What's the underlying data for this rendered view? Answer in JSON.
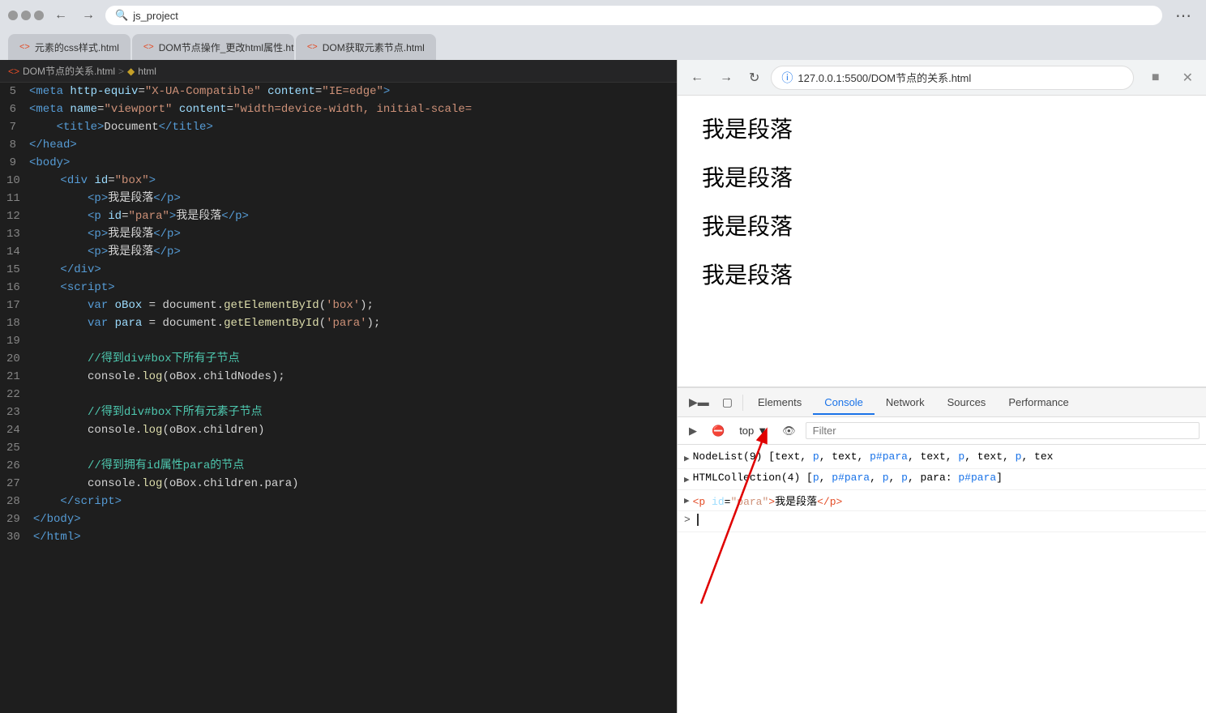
{
  "browser": {
    "title": "Document",
    "tabs": [
      {
        "label": "元素的css样式.html",
        "active": false
      },
      {
        "label": "DOM节点操作_更改html属性.html",
        "active": false
      },
      {
        "label": "DOM获取元素节点.html",
        "active": false
      }
    ],
    "search_placeholder": "js_project",
    "address": "127.0.0.1:5500/DOM节点的关系.html",
    "breadcrumb": [
      "DOM节点的关系.html",
      "html"
    ]
  },
  "devtools": {
    "tabs": [
      "Elements",
      "Console",
      "Network",
      "Sources",
      "Performance"
    ],
    "active_tab": "Console",
    "toolbar": {
      "top_label": "top",
      "filter_placeholder": "Filter"
    },
    "console_lines": [
      {
        "type": "expandable",
        "text": "NodeList(9) [text, p, text, p#para, text, p, text, p, tex"
      },
      {
        "type": "expandable",
        "text": "HTMLCollection(4) [p, p#para, p, p, para: p#para]"
      },
      {
        "type": "element",
        "text": "<p id=\"para\">我是段落</p>"
      }
    ],
    "prompt_text": ""
  },
  "preview": {
    "paragraphs": [
      "我是段落",
      "我是段落",
      "我是段落",
      "我是段落"
    ]
  },
  "code": {
    "lines": [
      {
        "num": 5,
        "html": "<span class='c-tag'>&lt;meta</span> <span class='c-attr'>http-equiv</span><span class='c-text'>=</span><span class='c-val'>\"X-UA-Compatible\"</span> <span class='c-attr'>content</span><span class='c-text'>=</span><span class='c-val'>\"IE=edge\"</span><span class='c-tag'>&gt;</span>"
      },
      {
        "num": 6,
        "html": "<span class='c-tag'>&lt;meta</span> <span class='c-attr'>name</span><span class='c-text'>=</span><span class='c-val'>\"viewport\"</span> <span class='c-attr'>content</span><span class='c-text'>=</span><span class='c-val'>\"width=device-width, initial-scale=</span>"
      },
      {
        "num": 7,
        "html": "    <span class='c-tag'>&lt;title&gt;</span><span class='c-text'>Document</span><span class='c-tag'>&lt;/title&gt;</span>"
      },
      {
        "num": 8,
        "html": "<span class='c-tag'>&lt;/head&gt;</span>"
      },
      {
        "num": 9,
        "html": "<span class='c-tag'>&lt;body&gt;</span>"
      },
      {
        "num": 10,
        "html": "    <span class='c-tag'>&lt;div</span> <span class='c-attr'>id</span><span class='c-text'>=</span><span class='c-val'>\"box\"</span><span class='c-tag'>&gt;</span>"
      },
      {
        "num": 11,
        "html": "        <span class='c-tag'>&lt;p&gt;</span><span class='c-text'>我是段落</span><span class='c-tag'>&lt;/p&gt;</span>"
      },
      {
        "num": 12,
        "html": "        <span class='c-tag'>&lt;p</span> <span class='c-attr'>id</span><span class='c-text'>=</span><span class='c-val'>\"para\"</span><span class='c-tag'>&gt;</span><span class='c-text'>我是段落</span><span class='c-tag'>&lt;/p&gt;</span>"
      },
      {
        "num": 13,
        "html": "        <span class='c-tag'>&lt;p&gt;</span><span class='c-text'>我是段落</span><span class='c-tag'>&lt;/p&gt;</span>"
      },
      {
        "num": 14,
        "html": "        <span class='c-tag'>&lt;p&gt;</span><span class='c-text'>我是段落</span><span class='c-tag'>&lt;/p&gt;</span>"
      },
      {
        "num": 15,
        "html": "    <span class='c-tag'>&lt;/div&gt;</span>"
      },
      {
        "num": 16,
        "html": "    <span class='c-tag'>&lt;script&gt;</span>"
      },
      {
        "num": 17,
        "html": "        <span class='c-keyword'>var</span> <span class='c-var'>oBox</span> <span class='c-text'>= document.</span><span class='c-fn'>getElementById</span><span class='c-text'>(</span><span class='c-string'>'box'</span><span class='c-text'>);</span>"
      },
      {
        "num": 18,
        "html": "        <span class='c-keyword'>var</span> <span class='c-var'>para</span> <span class='c-text'>= document.</span><span class='c-fn'>getElementById</span><span class='c-text'>(</span><span class='c-string'>'para'</span><span class='c-text'>);</span>"
      },
      {
        "num": 19,
        "html": ""
      },
      {
        "num": 20,
        "html": "        <span class='c-comment'>//得到div#box下所有子节点</span>"
      },
      {
        "num": 21,
        "html": "        <span class='c-text'>console.</span><span class='c-fn'>log</span><span class='c-text'>(oBox.childNodes);</span>"
      },
      {
        "num": 22,
        "html": ""
      },
      {
        "num": 23,
        "html": "        <span class='c-comment'>//得到div#box下所有元素子节点</span>"
      },
      {
        "num": 24,
        "html": "        <span class='c-text'>console.</span><span class='c-fn'>log</span><span class='c-text'>(oBox.children)</span>"
      },
      {
        "num": 25,
        "html": ""
      },
      {
        "num": 26,
        "html": "        <span class='c-comment'>//得到拥有id属性para的节点</span>"
      },
      {
        "num": 27,
        "html": "        <span class='c-text'>console.</span><span class='c-fn'>log</span><span class='c-text'>(oBox.children.para)</span>"
      },
      {
        "num": 28,
        "html": "    <span class='c-tag'>&lt;/script&gt;</span>"
      },
      {
        "num": 29,
        "html": "<span class='c-tag'>&lt;/body&gt;</span>"
      },
      {
        "num": 30,
        "html": "<span class='c-tag'>&lt;/html&gt;</span>"
      }
    ]
  }
}
